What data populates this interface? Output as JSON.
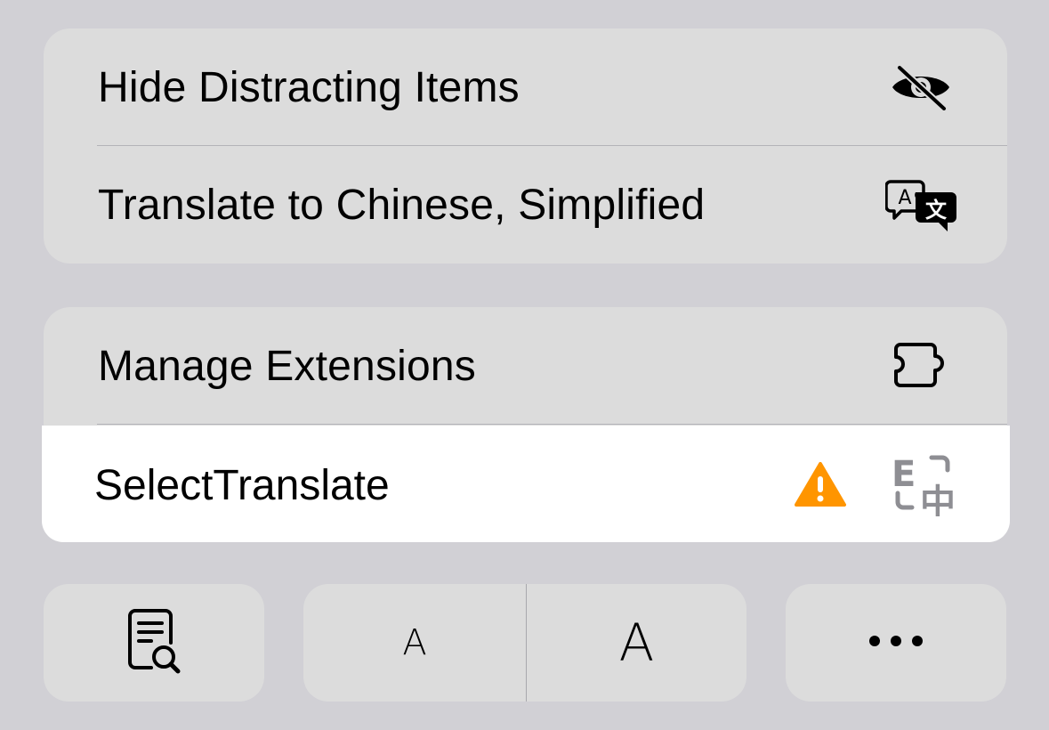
{
  "menu": {
    "group1": {
      "items": [
        {
          "label": "Hide Distracting Items",
          "icon": "eye-slash-icon"
        },
        {
          "label": "Translate to Chinese, Simplified",
          "icon": "translate-bubble-icon"
        }
      ]
    },
    "group2": {
      "items": [
        {
          "label": "Manage Extensions",
          "icon": "puzzle-piece-icon"
        },
        {
          "label": "SelectTranslate",
          "icon": "select-translate-extension-icon",
          "status_icon": "warning-triangle-icon",
          "highlighted": true
        }
      ]
    },
    "toolbar": {
      "reader_icon": "reader-search-icon",
      "font_small_label": "A",
      "font_large_label": "A",
      "more_icon": "ellipsis-icon"
    }
  },
  "colors": {
    "background": "#d1d0d5",
    "group": "#dcdcdc",
    "highlight": "#ffffff",
    "warning": "#ff9500"
  }
}
